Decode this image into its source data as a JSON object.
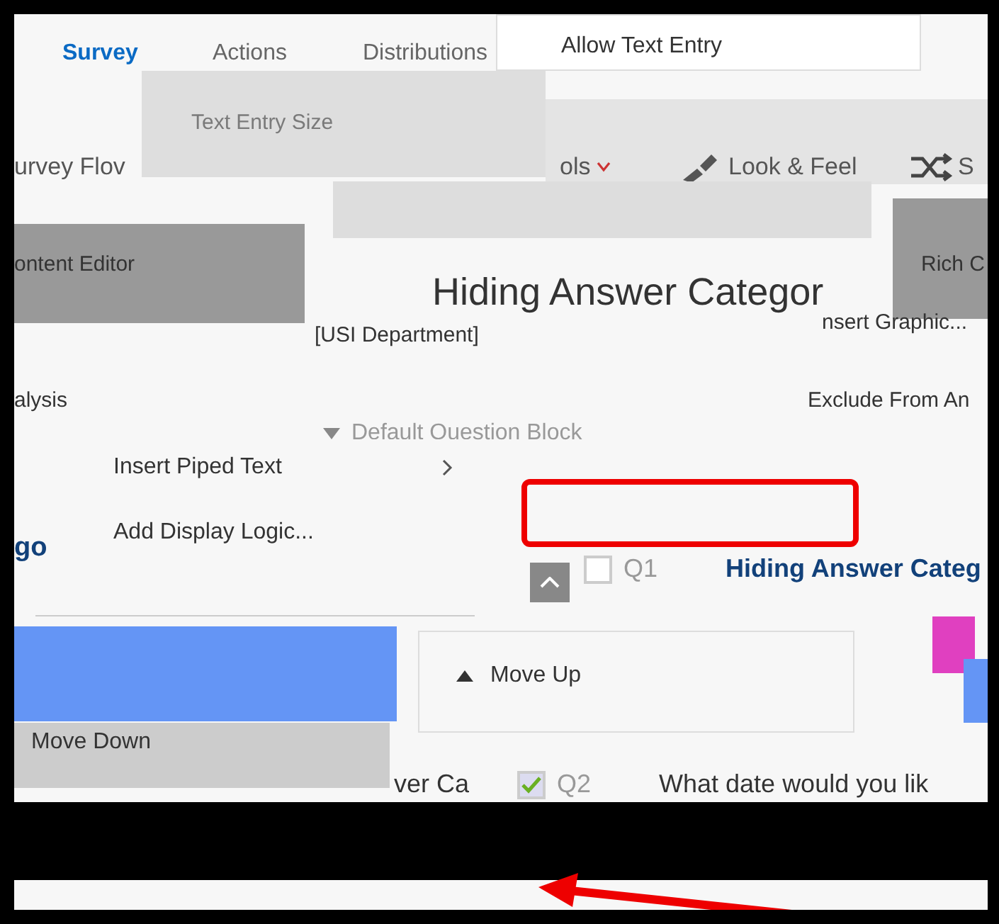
{
  "nav_tabs": [
    {
      "label": "Survey",
      "selected": true
    },
    {
      "label": "Actions",
      "selected": false
    },
    {
      "label": "Distributions",
      "selected": false
    }
  ],
  "text_entry_menu": {
    "title": "Allow Text Entry",
    "items": [
      {
        "label": "Text Entry Size",
        "disabled": true
      }
    ]
  },
  "toolbar": [
    {
      "label": "urvey Flov",
      "kind": "plain"
    },
    {
      "label": "ols",
      "kind": "caret"
    },
    {
      "label": "Look & Feel",
      "kind": "brush"
    },
    {
      "label": "S",
      "kind": "shuffle"
    }
  ],
  "left_panel": {
    "items": [
      "ontent Editor",
      "alysis"
    ]
  },
  "right_panel": {
    "items": [
      "Rich C",
      "nsert Graphic...",
      "Exclude From An"
    ]
  },
  "editor": {
    "title": "Hiding Answer Categor",
    "field": "[USI Department]"
  },
  "block": {
    "title": "Default Question Block",
    "expanded": true
  },
  "context_menu": [
    {
      "label": "Insert Piped Text",
      "submenu": true
    },
    {
      "label": "Add Display Logic...",
      "submenu": false
    }
  ],
  "move_menu": [
    {
      "label": "Move Up",
      "kind": "up",
      "selected": false
    },
    {
      "label": "Move Down",
      "kind": "plain",
      "selected": true
    }
  ],
  "questions": [
    {
      "number": "Q1",
      "text": "Hiding Answer Categ",
      "checked": false
    },
    {
      "number": "Q2",
      "text": "What date would you lik",
      "checked": true
    }
  ],
  "fragments": [
    "go",
    "ver Ca"
  ]
}
